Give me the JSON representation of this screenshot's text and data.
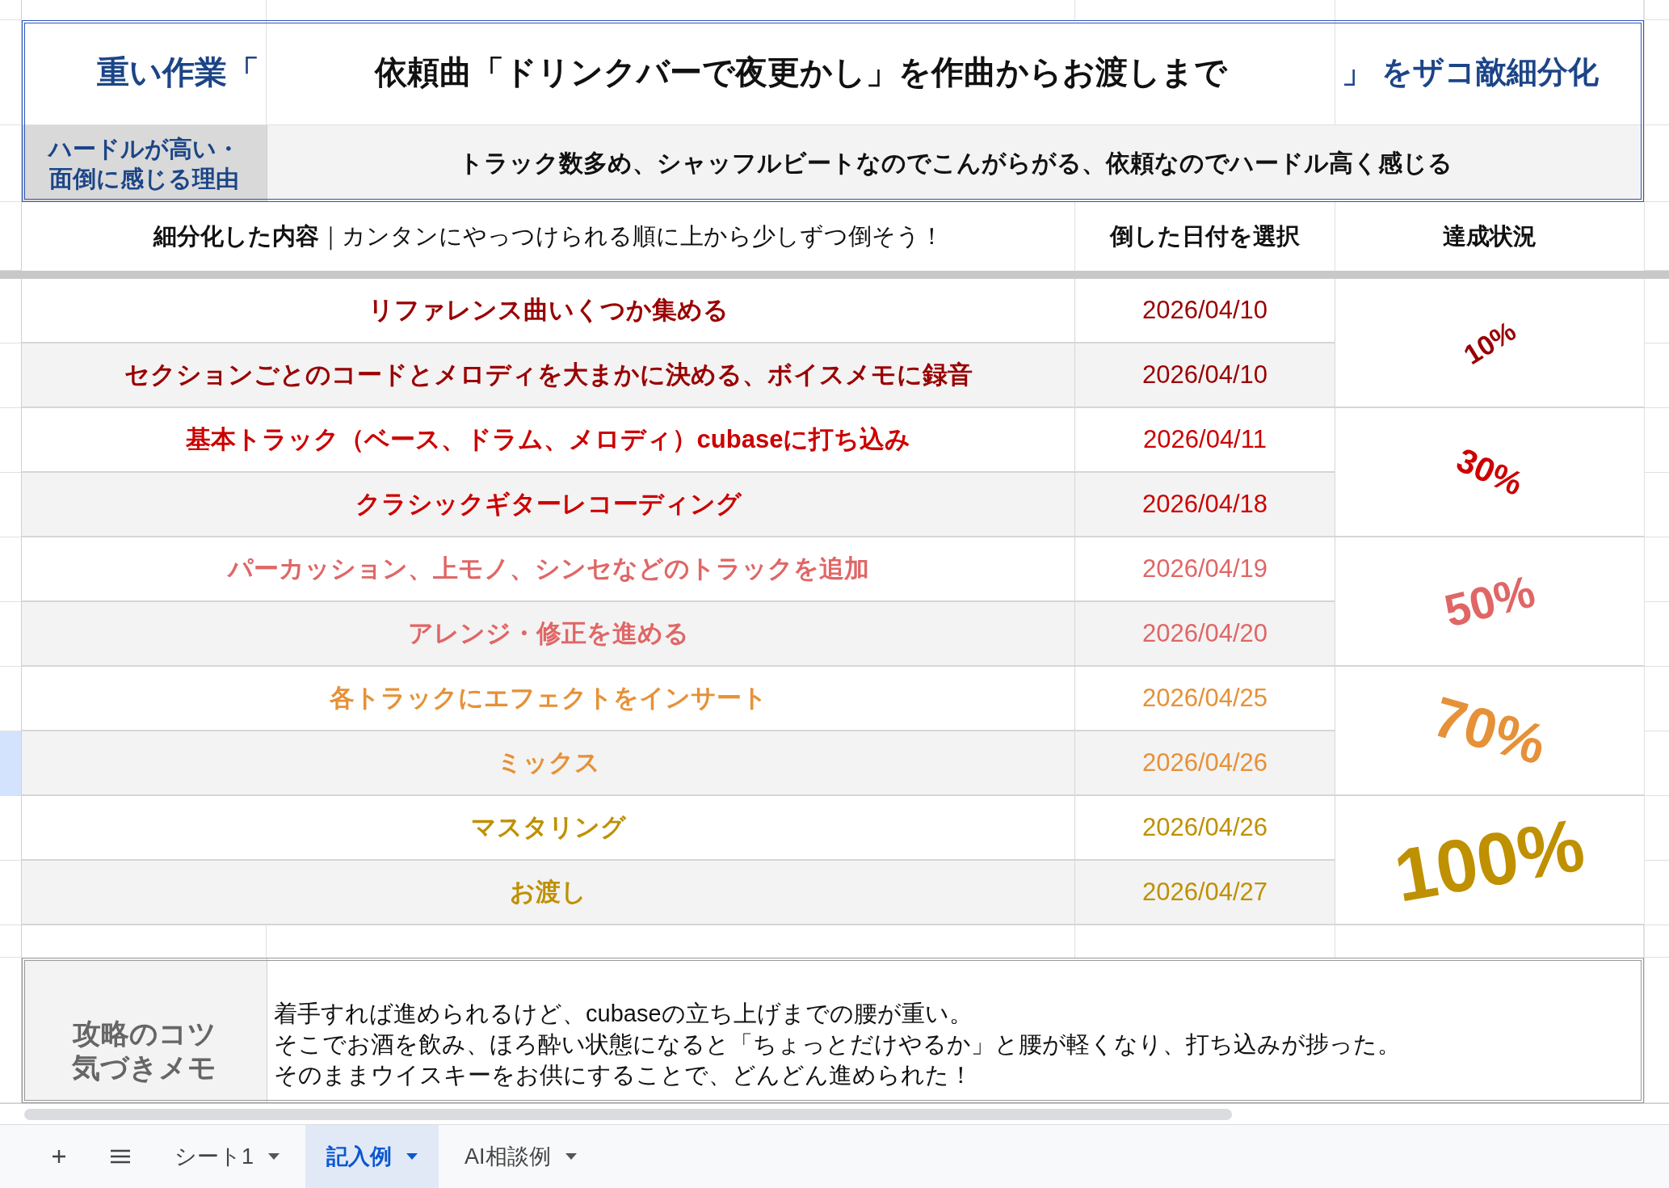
{
  "title": {
    "prefix": "重い作業「",
    "main": "依頼曲「ドリンクバーで夜更かし」を作曲からお渡しまで",
    "suffix": "」 をザコ敵細分化"
  },
  "reason": {
    "label": "ハードルが高い・面倒に感じる理由",
    "text": "トラック数多め、シャッフルビートなのでこんがらがる、依頼なのでハードル高く感じる"
  },
  "columns": [
    "**細分化した内容**｜カンタンにやっつけられる順に上から少しずつ倒そう！",
    "倒した日付を選択",
    "達成状況"
  ],
  "tasks": [
    {
      "text": "リファレンス曲いくつか集める",
      "date": "2026/04/10",
      "color": "#990000",
      "selected": false
    },
    {
      "text": "セクションごとのコードとメロディを大まかに決める、ボイスメモに録音",
      "date": "2026/04/10",
      "color": "#990000",
      "selected": false
    },
    {
      "text": "基本トラック（ベース、ドラム、メロディ）cubaseに打ち込み",
      "date": "2026/04/11",
      "color": "#cc0000",
      "selected": false
    },
    {
      "text": "クラシックギターレコーディング",
      "date": "2026/04/18",
      "color": "#cc0000",
      "selected": false
    },
    {
      "text": "パーカッション、上モノ、シンセなどのトラックを追加",
      "date": "2026/04/19",
      "color": "#e06666",
      "selected": false
    },
    {
      "text": "アレンジ・修正を進める",
      "date": "2026/04/20",
      "color": "#e06666",
      "selected": false
    },
    {
      "text": "各トラックにエフェクトをインサート",
      "date": "2026/04/25",
      "color": "#e69138",
      "selected": false
    },
    {
      "text": "ミックス",
      "date": "2026/04/26",
      "color": "#e69138",
      "selected": true
    },
    {
      "text": "マスタリング",
      "date": "2026/04/26",
      "color": "#bf9000",
      "selected": false
    },
    {
      "text": "お渡し",
      "date": "2026/04/27",
      "color": "#bf9000",
      "selected": false
    }
  ],
  "stages": [
    {
      "label": "10%",
      "color": "#990000"
    },
    {
      "label": "30%",
      "color": "#cc0000"
    },
    {
      "label": "50%",
      "color": "#e06666"
    },
    {
      "label": "70%",
      "color": "#e69138"
    },
    {
      "label": "100%",
      "color": "#bf9000"
    }
  ],
  "memo": {
    "label": "攻略のコツ気づきメモ",
    "lines": [
      "着手すれば進められるけど、cubaseの立ち上げまでの腰が重い。",
      "そこでお酒を飲み、ほろ酔い状態になると「ちょっとだけやるか」と腰が軽くなり、打ち込みが捗った。",
      "そのままウイスキーをお供にすることで、どんどん進められた！"
    ]
  },
  "sheet_tabs": [
    {
      "label": "シート1",
      "selected": false
    },
    {
      "label": "記入例",
      "selected": true
    },
    {
      "label": "AI相談例",
      "selected": false
    }
  ]
}
